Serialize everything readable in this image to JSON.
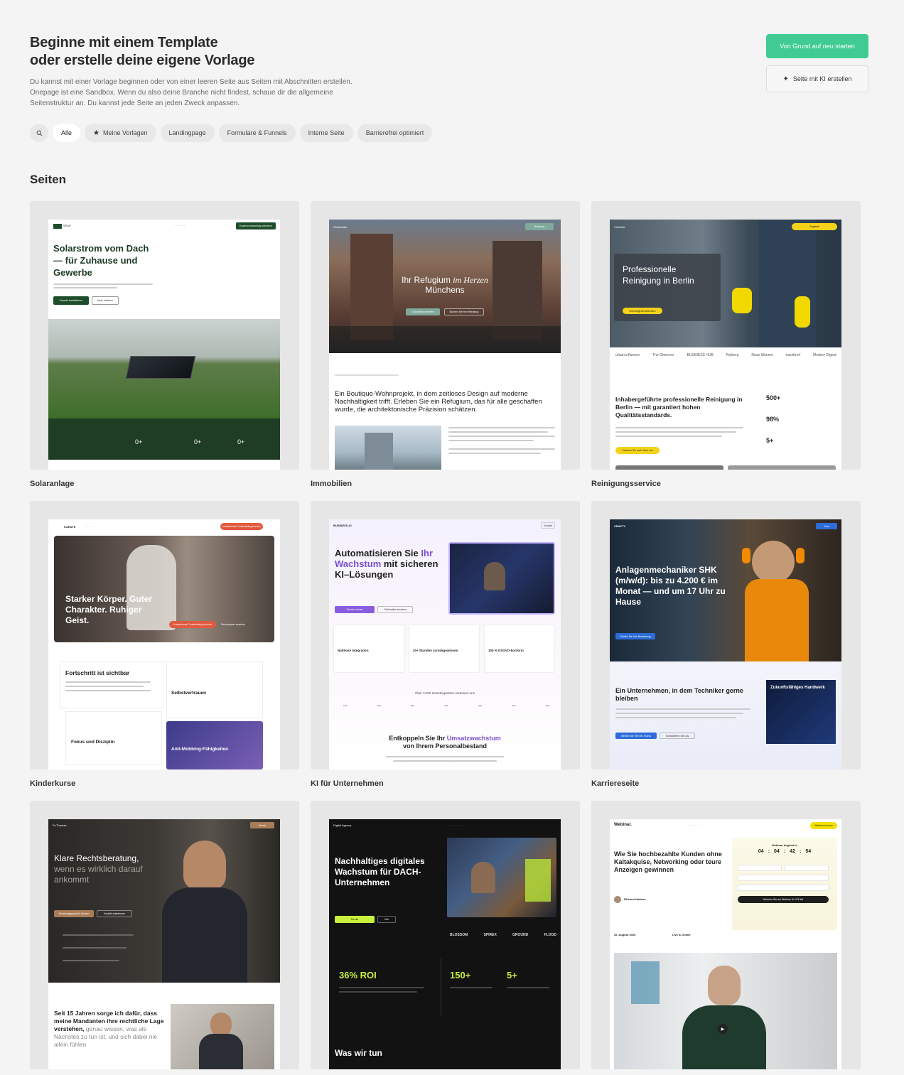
{
  "header": {
    "title_line1": "Beginne mit einem Template",
    "title_line2": "oder erstelle deine eigene Vorlage",
    "description": "Du kannst mit einer Vorlage beginnen oder von einer leeren Seite aus Seiten mit Abschnitten erstellen. Onepage ist eine Sandbox. Wenn du also deine Branche nicht findest, schaue dir die allgemeine Seitenstruktur an. Du kannst jede Seite an jeden Zweck anpassen."
  },
  "actions": {
    "start_blank": "Von Grund auf neu starten",
    "create_ai": "Seite mit KI erstellen"
  },
  "filters": {
    "all": "Alle",
    "my_templates": "Meine Vorlagen",
    "landing": "Landingpage",
    "forms": "Formulare & Funnels",
    "internal": "Interne Seite",
    "accessible": "Barrierefrei optimiert"
  },
  "section": {
    "title": "Seiten"
  },
  "cards": [
    {
      "label": "Solaranlage",
      "headline": "Solarstrom vom Dach — für Zuhause und Gewerbe",
      "brand": "SEAP",
      "nav_cta": "Kostenvoranschlag anfordern",
      "btn1": "Experte kontaktieren",
      "btn2": "Mehr erfahren",
      "stat1": "0+",
      "stat2": "0+",
      "stat3": "0+"
    },
    {
      "label": "Immobilien",
      "brand": "RealEstate",
      "hero_a": "Ihr Refugium",
      "hero_b": "im Herzen",
      "hero_c": "Münchens",
      "btn1": "Grundrisse ansehen",
      "btn2": "Buchen Sie eine Beratung",
      "intro": "Ein Boutique-Wohnprojekt, in dem zeitloses Design auf moderne Nachhaltigkeit trifft. Erleben Sie ein Refugium, das für alle geschaffen wurde, die architektonische Präzision schätzen."
    },
    {
      "label": "Reinigungsservice",
      "brand": "CleanDe",
      "hero": "Professionelle Reinigung in Berlin",
      "btn1": "Jetzt Angebot anfordern",
      "sub": "Inhabergeführte professionelle Reinigung in Berlin — mit garantiert hohen Qualitätsstandards.",
      "stat1": "500+",
      "stat2": "98%",
      "stat3": "5+",
      "btn2": "Erfahren Sie mehr über uns",
      "logos": [
        "urban influence",
        "The Observer",
        "BUSINESS HUB",
        "Ro|berg",
        "Neue Stimme",
        "trackbrief",
        "Modern Digest."
      ]
    },
    {
      "label": "Kinderkurse",
      "brand": "KARATE",
      "nav_cta": "Kostenloses Probetraining buchen",
      "hero": "Starker Körper. Guter Charakter. Ruhiger Geist.",
      "btn1": "Kostenloses Probetraining buchen",
      "btn2": "Stundenplan ansehen",
      "section": "Fortschritt ist sichtbar",
      "f1": "Selbstvertrauen",
      "f2": "Fokus und Disziplin",
      "f3": "Anti-Mobbing-Fähigkeiten"
    },
    {
      "label": "KI für Unternehmen",
      "brand": "BUSINESS.AI",
      "nav_cta": "Kontakt",
      "hero_a": "Automatisieren Sie",
      "hero_b": "Ihr Wachstum",
      "hero_c": "mit sicheren KI–Lösungen",
      "btn1": "Termin buchen",
      "btn2": "Fallstudien ansehen",
      "f1": "Nahtlose Integration",
      "f2": "20+ Stunden zurückgewinnen",
      "f3": "100 % DSGVO-konform",
      "trust": "Über 3.200 Industriepartner vertrauen uns",
      "bottom_a": "Entkoppeln Sie Ihr",
      "bottom_b": "Umsatzwachstum",
      "bottom_c": "von Ihrem Personalbestand"
    },
    {
      "label": "Karriereseite",
      "brand": "CRAFTY",
      "hero": "Anlagenmechaniker SHK (m/w/d): bis zu 4.200 € im Monat — und um 17 Uhr zu Hause",
      "btn1": "Starten Sie Ihre Bewerbung",
      "sub": "Ein Unternehmen, in dem Techniker gerne bleiben",
      "box": "Zukunftsfähiges Handwerk",
      "btn2": "Werden Sie Teil des Teams",
      "btn3": "Kontaktieren Sie uns"
    },
    {
      "label": "",
      "brand": "Dr.Thomas",
      "hero_a": "Klare Rechtsberatung,",
      "hero_b": "wenn es wirklich darauf ankommt",
      "btn1": "Beratungsgespräch buchen",
      "btn2": "Kontakt aufnehmen",
      "sub_a": "Seit 15 Jahren sorge ich dafür, dass meine Mandanten ihre rechtliche Lage verstehen,",
      "sub_b": "genau wissen, was als Nächstes zu tun ist, und sich dabei nie allein fühlen"
    },
    {
      "label": "",
      "brand": "Digital Agency",
      "hero": "Nachhaltiges digitales Wachstum für DACH-Unternehmen",
      "stat1": "36% ROI",
      "stat2": "150+",
      "stat3": "5+",
      "bottom": "Was wir tun",
      "logos": [
        "BLOSSOM",
        "SPIREX",
        "GROUND",
        "FLOOD"
      ]
    },
    {
      "label": "",
      "brand": "Webinar.",
      "nav_cta": "Webinar buchen",
      "hero": "Wie Sie hochbezahlte Kunden ohne Kaltakquise, Networking oder teure Anzeigen gewinnen",
      "presenter": "Richard Hadson",
      "countdown_label": "Webinar beginnt in",
      "cd1": "04",
      "cd2": "04",
      "cd3": "42",
      "cd4": "54",
      "date": "26. August 2026",
      "mode": "Live & Online",
      "btn1": "Nehmen Sie am Webinar für 47€ teil"
    }
  ]
}
